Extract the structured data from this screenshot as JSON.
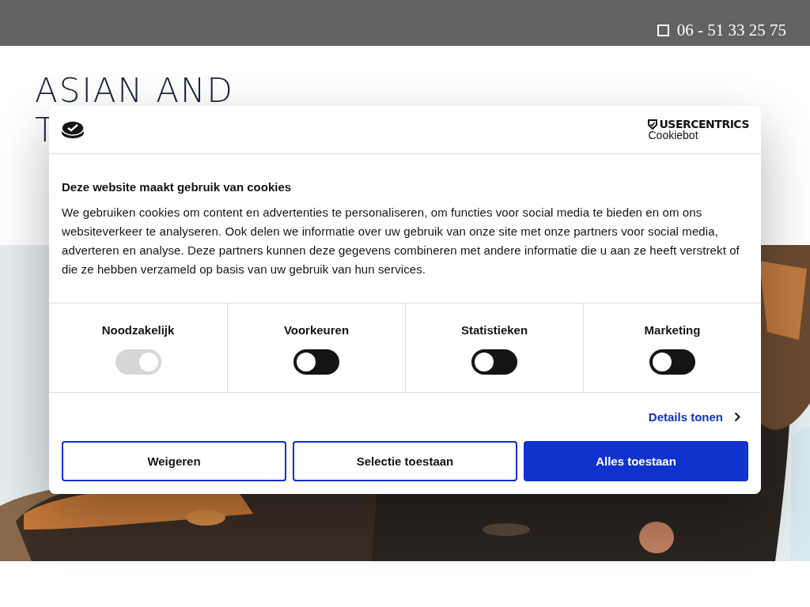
{
  "top_bar": {
    "phone": "06 - 51 33 25 75"
  },
  "logo": {
    "lines": [
      "ASIAN AND",
      "T"
    ]
  },
  "cookie_dialog": {
    "brand": {
      "name": "USERCENTRICS",
      "sub": "Cookiebot"
    },
    "title": "Deze website maakt gebruik van cookies",
    "text": "We gebruiken cookies om content en advertenties te personaliseren, om functies voor social media te bieden en om ons websiteverkeer te analyseren. Ook delen we informatie over uw gebruik van onze site met onze partners voor social media, adverteren en analyse. Deze partners kunnen deze gegevens combineren met andere informatie die u aan ze heeft verstrekt of die ze hebben verzameld op basis van uw gebruik van hun services.",
    "categories": [
      {
        "label": "Noodzakelijk",
        "on": true,
        "disabled": true
      },
      {
        "label": "Voorkeuren",
        "on": false,
        "disabled": false
      },
      {
        "label": "Statistieken",
        "on": false,
        "disabled": false
      },
      {
        "label": "Marketing",
        "on": false,
        "disabled": false
      }
    ],
    "details_link": "Details tonen",
    "buttons": [
      {
        "label": "Weigeren",
        "kind": "outline"
      },
      {
        "label": "Selectie toestaan",
        "kind": "outline"
      },
      {
        "label": "Alles toestaan",
        "kind": "primary"
      }
    ]
  }
}
